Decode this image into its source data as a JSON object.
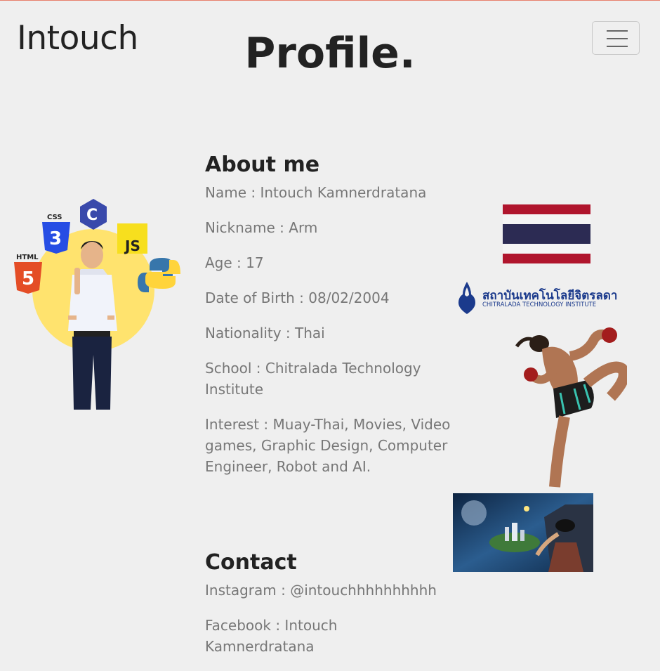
{
  "brand": "Intouch",
  "page_title": "Profile.",
  "menu_icon": "hamburger-menu-icon",
  "about": {
    "heading": "About me",
    "items": [
      "Name : Intouch Kamnerdratana",
      "Nickname : Arm",
      "Age : 17",
      "Date of Birth : 08/02/2004",
      "Nationality : Thai",
      "School : Chitralada Technology Institute",
      "Interest : Muay-Thai, Movies, Video games, Graphic Design, Computer Engineer, Robot and AI."
    ]
  },
  "contact": {
    "heading": "Contact",
    "items": [
      "Instagram : @intouchhhhhhhhhh",
      "Facebook : Intouch Kamnerdratana"
    ]
  },
  "portrait_badges": [
    "HTML",
    "CSS",
    "C",
    "JS"
  ],
  "logo": {
    "thai": "สถาบันเทคโนโลยีจิตรลดา",
    "english": "CHITRALADA TECHNOLOGY INSTITUTE"
  },
  "colors": {
    "background": "#efefef",
    "flag_red": "#b0152d",
    "flag_blue": "#2c2b53",
    "highlight_circle": "#ffe36e"
  }
}
